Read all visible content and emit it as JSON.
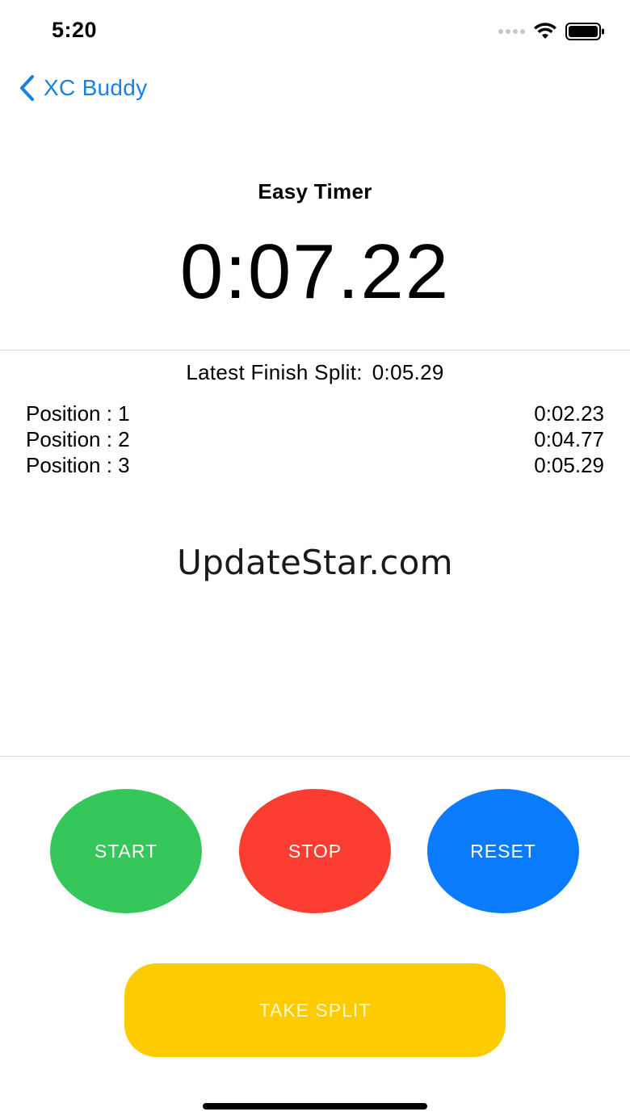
{
  "status_bar": {
    "time": "5:20"
  },
  "nav": {
    "back_label": "XC Buddy",
    "accent_color": "#1b7fe3"
  },
  "timer": {
    "title": "Easy Timer",
    "display": "0:07.22"
  },
  "latest_split": {
    "label": "Latest Finish Split:",
    "value": "0:05.29"
  },
  "splits": [
    {
      "position": "Position : 1",
      "time": "0:02.23"
    },
    {
      "position": "Position : 2",
      "time": "0:04.77"
    },
    {
      "position": "Position : 3",
      "time": "0:05.29"
    }
  ],
  "watermark": "UpdateStar.com",
  "controls": {
    "start": {
      "label": "START",
      "color": "#36c75a"
    },
    "stop": {
      "label": "STOP",
      "color": "#fc3d32"
    },
    "reset": {
      "label": "RESET",
      "color": "#0a7bfd"
    },
    "split": {
      "label": "TAKE SPLIT",
      "color": "#fdcb00"
    }
  }
}
